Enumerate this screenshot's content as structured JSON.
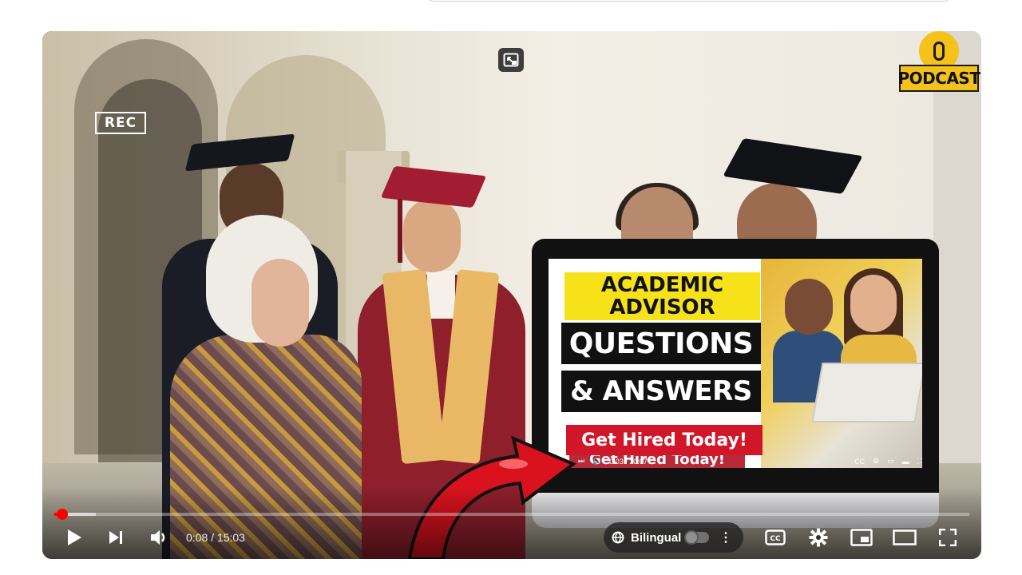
{
  "overlay": {
    "rec_label": "REC",
    "podcast_label": "PODCAST"
  },
  "thumbnail": {
    "line1": "ACADEMIC",
    "line2": "ADVISOR",
    "line3": "QUESTIONS",
    "line4": "& ANSWERS",
    "line5": "Get Hired Today!",
    "ghost_line": "Get Hired Today!",
    "mini_time": "0:03 / 10:07"
  },
  "player": {
    "time_current": "0:08",
    "time_separator": " / ",
    "time_total": "15:03",
    "time_display": "0:08 / 15:03",
    "progress_played_fraction": 0.009,
    "progress_loaded_fraction": 0.045,
    "bilingual_label": "Bilingual",
    "bilingual_enabled": false,
    "accent_color": "#ff0000"
  },
  "icons": {
    "play": "play-icon",
    "next": "next-icon",
    "volume": "volume-icon",
    "captions": "cc-icon",
    "settings": "gear-icon",
    "miniplayer": "miniplayer-icon",
    "theater": "theater-icon",
    "fullscreen": "fullscreen-icon",
    "more": "more-vertical-icon",
    "language": "language-icon",
    "exit_miniplayer": "expand-icon"
  }
}
